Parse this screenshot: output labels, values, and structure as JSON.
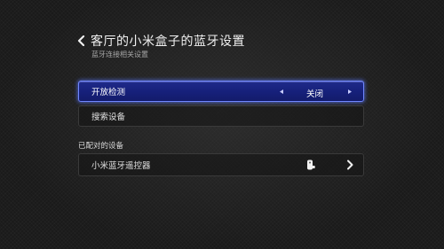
{
  "header": {
    "title": "客厅的小米盒子的蓝牙设置",
    "subtitle": "蓝牙连接相关设置"
  },
  "settings": {
    "open_detection": {
      "label": "开放检测",
      "value": "关闭"
    },
    "search_devices": {
      "label": "搜索设备"
    }
  },
  "paired": {
    "section_label": "已配对的设备",
    "devices": [
      {
        "label": "小米蓝牙遥控器",
        "icon": "remote-control-icon"
      }
    ]
  },
  "colors": {
    "focus_border": "#6f86ff",
    "focus_fill": "#1a2380",
    "background": "#1a1a1a"
  }
}
